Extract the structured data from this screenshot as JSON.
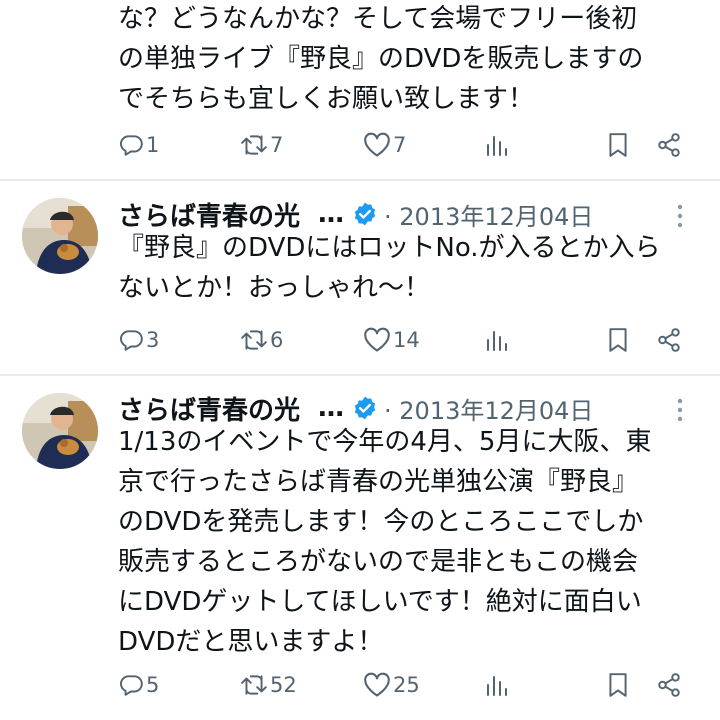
{
  "tweets": [
    {
      "text": "な？どうなんかな？そして会場でフリー後初\nの単独ライブ『野良』のDVDを販売しますの\nでそちらも宜しくお願い致します！",
      "reply_count": "1",
      "retweet_count": "7",
      "like_count": "7"
    },
    {
      "name": "さらば青春の光",
      "ellipsis": "…",
      "date": "· 2013年12月04日",
      "text": "『野良』のDVDにはロットNo.が入るとか入ら\nないとか！おっしゃれ〜！",
      "reply_count": "3",
      "retweet_count": "6",
      "like_count": "14"
    },
    {
      "name": "さらば青春の光",
      "ellipsis": "…",
      "date": "· 2013年12月04日",
      "text": "1/13のイベントで今年の4月、5月に大阪、東\n京で行ったさらば青春の光単独公演『野良』\nのDVDを発売します！今のところここでしか\n販売するところがないので是非ともこの機会\nにDVDゲットしてほしいです！絶対に面白い\nDVDだと思いますよ！",
      "reply_count": "5",
      "retweet_count": "52",
      "like_count": "25"
    }
  ],
  "colors": {
    "text": "#0f1419",
    "muted": "#536471",
    "verified": "#1d9bf0",
    "divider": "#e6ecf0"
  },
  "icons": [
    "reply-icon",
    "retweet-icon",
    "like-icon",
    "views-icon",
    "bookmark-icon",
    "share-icon",
    "verified-badge-icon",
    "more-icon"
  ]
}
